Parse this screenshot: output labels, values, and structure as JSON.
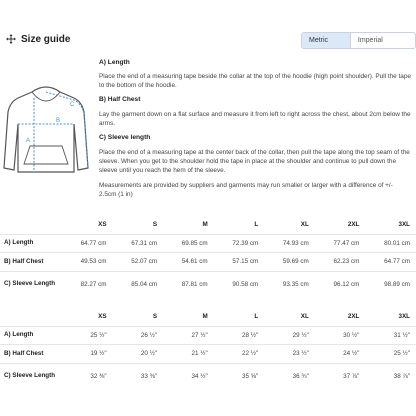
{
  "header": {
    "title": "Size guide",
    "units": [
      "Metric (cm)",
      "Imperial (inches)"
    ],
    "selected_unit": "Metric (cm)"
  },
  "diagram": {
    "labels": [
      "A",
      "B",
      "C"
    ]
  },
  "instructions": {
    "a_title": "A) Length",
    "a_text": "Place the end of a measuring tape beside the collar at the top of the hoodie (high point shoulder). Pull the tape to the bottom of the hoodie.",
    "b_title": "B) Half Chest",
    "b_text": "Lay the garment down on a flat surface and measure it from left to right across the chest, about 2cm below the arms.",
    "c_title": "C) Sleeve length",
    "c_text": "Place the end of a measuring tape at the center back of the collar, then pull the tape along the top seam of the sleeve. When you get to the shoulder hold the tape in place at the shoulder and continue to pull down the sleeve until you reach the hem of the sleeve.",
    "note": "Measurements are provided by suppliers and garments may run smaller or larger with a difference of +/- 2.5cm (1 in)"
  },
  "sizes": [
    "XS",
    "S",
    "M",
    "L",
    "XL",
    "2XL",
    "3XL"
  ],
  "metric_rows": [
    {
      "label": "A) Length",
      "values": [
        "64.77 cm",
        "67.31 cm",
        "69.85 cm",
        "72.39 cm",
        "74.93 cm",
        "77.47 cm",
        "80.01 cm"
      ]
    },
    {
      "label": "B) Half Chest",
      "values": [
        "49.53 cm",
        "52.07 cm",
        "54.61 cm",
        "57.15 cm",
        "59.69 cm",
        "62.23 cm",
        "64.77 cm"
      ]
    },
    {
      "label": "C) Sleeve Length",
      "values": [
        "82.27 cm",
        "85.04 cm",
        "87.81 cm",
        "90.58 cm",
        "93.35 cm",
        "96.12 cm",
        "98.89 cm"
      ]
    }
  ],
  "imperial_rows": [
    {
      "label": "A) Length",
      "values": [
        "25 ½\"",
        "26 ½\"",
        "27 ½\"",
        "28 ½\"",
        "29 ½\"",
        "30 ½\"",
        "31 ½\""
      ]
    },
    {
      "label": "B) Half Chest",
      "values": [
        "19 ½\"",
        "20 ½\"",
        "21 ½\"",
        "22 ½\"",
        "23 ½\"",
        "24 ½\"",
        "25 ½\""
      ]
    },
    {
      "label": "C) Sleeve Length",
      "values": [
        "32 ⅜\"",
        "33 ⅜\"",
        "34 ½\"",
        "35 ⅝\"",
        "36 ¾\"",
        "37 ⅞\"",
        "38 ⅞\""
      ]
    }
  ],
  "colors": {
    "accent_blue": "#4a90d9",
    "toggle_active": "#dbe8f8",
    "outline": "#555555"
  }
}
